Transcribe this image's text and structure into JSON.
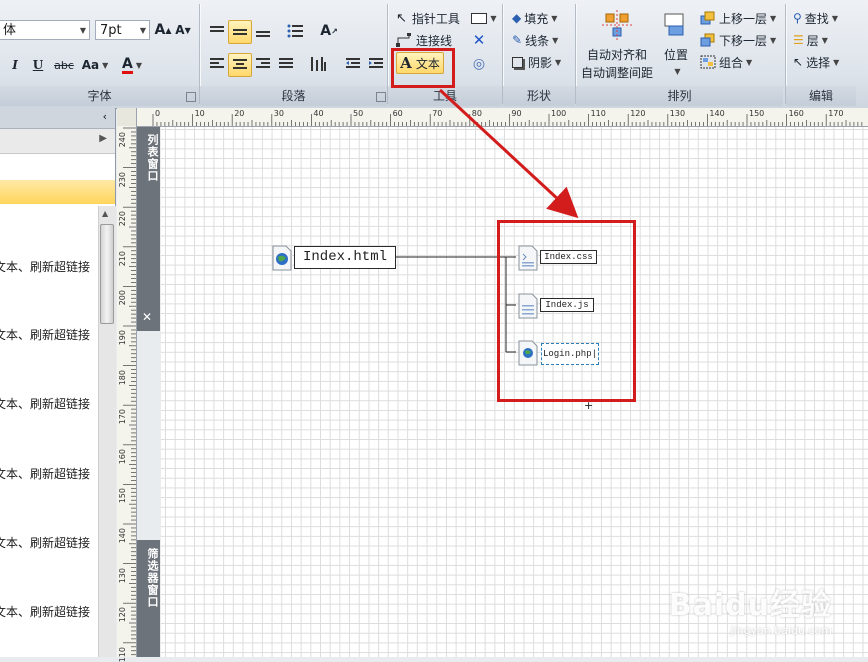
{
  "ribbon": {
    "font_group": {
      "label": "字体",
      "font_name": "体",
      "font_size": "7pt",
      "grow_font": "A",
      "shrink_font": "A",
      "italic": "I",
      "underline": "U",
      "strike": "abc",
      "change_case": "Aa",
      "font_color": "A"
    },
    "paragraph_group": {
      "label": "段落"
    },
    "tools_group": {
      "label": "工具",
      "pointer": "指针工具",
      "connector": "连接线",
      "text": "文本"
    },
    "shape_group": {
      "label": "形状",
      "fill": "填充",
      "line": "线条",
      "shadow": "阴影"
    },
    "arrange_group": {
      "label": "排列",
      "auto_align": "自动对齐和",
      "auto_space": "自动调整间距",
      "position": "位置",
      "bring_forward": "上移一层",
      "send_backward": "下移一层",
      "group": "组合"
    },
    "edit_group": {
      "label": "编辑",
      "find": "查找",
      "layer": "层",
      "select": "选择"
    }
  },
  "left_panel": {
    "items": [
      "文本、刷新超链接",
      "文本、刷新超链接",
      "文本、刷新超链接",
      "文本、刷新超链接",
      "文本、刷新超链接",
      "文本、刷新超链接"
    ]
  },
  "docked_windows": {
    "list": "列表窗口",
    "filter": "筛选器窗口"
  },
  "rulers": {
    "horizontal": [
      "0",
      "10",
      "20",
      "30",
      "40",
      "50",
      "60",
      "70",
      "80",
      "90",
      "100",
      "110",
      "120",
      "130",
      "140",
      "150",
      "160",
      "170"
    ],
    "vertical": [
      "240",
      "230",
      "220",
      "210",
      "200",
      "190",
      "180",
      "170",
      "160",
      "150",
      "140",
      "130",
      "120",
      "110"
    ]
  },
  "diagram": {
    "main_node": "Index.html",
    "children": [
      "Index.css",
      "Index.js",
      "Login.php|"
    ]
  },
  "watermark": {
    "brand": "Baidu经验",
    "url": "jingyan.baidu.com"
  },
  "colors": {
    "highlight_red": "#d31d1d",
    "selected_yellow": "#ffd86b",
    "docked_strip": "#6d737a"
  }
}
